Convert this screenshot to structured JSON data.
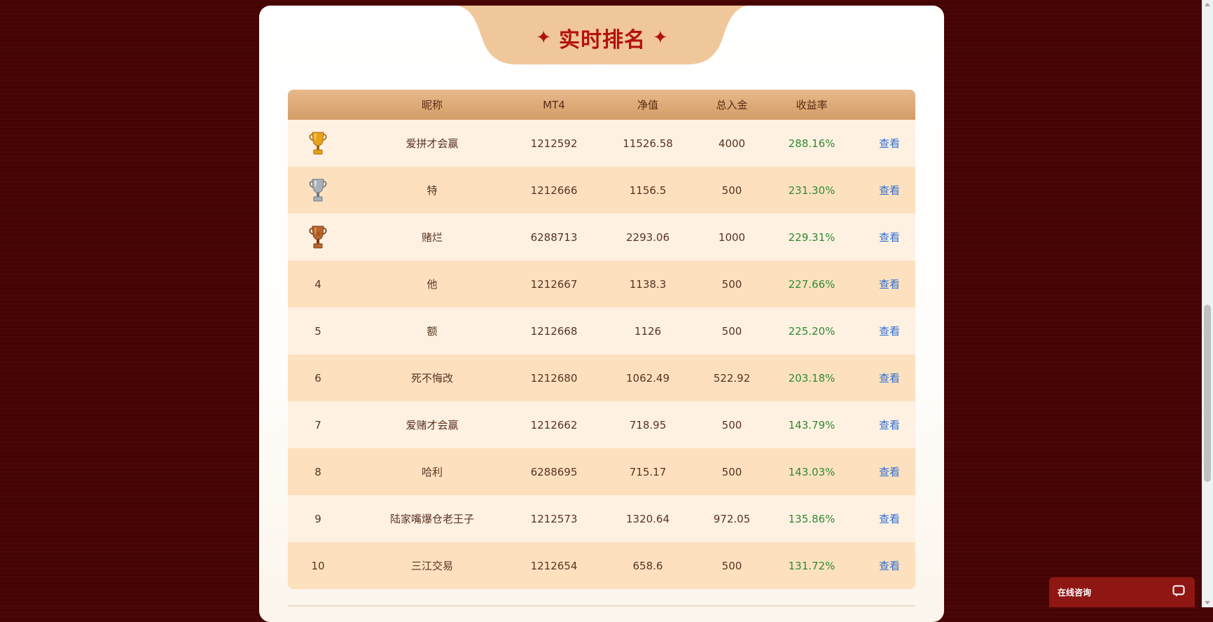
{
  "title": "实时排名",
  "title_star": "✦",
  "columns": {
    "rank": "",
    "name": "昵称",
    "mt4": "MT4",
    "nav": "净值",
    "deposit": "总入金",
    "rate": "收益率",
    "action": ""
  },
  "rows": [
    {
      "rank": "1",
      "rank_icon": "gold-trophy-icon",
      "name": "爱拼才会赢",
      "mt4": "1212592",
      "nav": "11526.58",
      "deposit": "4000",
      "rate": "288.16%",
      "action": "查看"
    },
    {
      "rank": "2",
      "rank_icon": "silver-trophy-icon",
      "name": "特",
      "mt4": "1212666",
      "nav": "1156.5",
      "deposit": "500",
      "rate": "231.30%",
      "action": "查看"
    },
    {
      "rank": "3",
      "rank_icon": "bronze-trophy-icon",
      "name": "赌烂",
      "mt4": "6288713",
      "nav": "2293.06",
      "deposit": "1000",
      "rate": "229.31%",
      "action": "查看"
    },
    {
      "rank": "4",
      "name": "他",
      "mt4": "1212667",
      "nav": "1138.3",
      "deposit": "500",
      "rate": "227.66%",
      "action": "查看"
    },
    {
      "rank": "5",
      "name": "额",
      "mt4": "1212668",
      "nav": "1126",
      "deposit": "500",
      "rate": "225.20%",
      "action": "查看"
    },
    {
      "rank": "6",
      "name": "死不悔改",
      "mt4": "1212680",
      "nav": "1062.49",
      "deposit": "522.92",
      "rate": "203.18%",
      "action": "查看"
    },
    {
      "rank": "7",
      "name": "爱赌才会赢",
      "mt4": "1212662",
      "nav": "718.95",
      "deposit": "500",
      "rate": "143.79%",
      "action": "查看"
    },
    {
      "rank": "8",
      "name": "哈利",
      "mt4": "6288695",
      "nav": "715.17",
      "deposit": "500",
      "rate": "143.03%",
      "action": "查看"
    },
    {
      "rank": "9",
      "name": "陆家嘴爆仓老王子",
      "mt4": "1212573",
      "nav": "1320.64",
      "deposit": "972.05",
      "rate": "135.86%",
      "action": "查看"
    },
    {
      "rank": "10",
      "name": "三江交易",
      "mt4": "1212654",
      "nav": "658.6",
      "deposit": "500",
      "rate": "131.72%",
      "action": "查看"
    }
  ],
  "chat": {
    "label": "在线咨询",
    "icon": "chat-bubble-icon"
  },
  "colors": {
    "background": "#4a0606",
    "title": "#b3120c",
    "header_gold": "#d49d67",
    "row_light": "#fff1e2",
    "row_dark": "#fde1bf",
    "rate_green": "#2f8a32",
    "link_blue": "#2f6fd1",
    "chat_bg": "#8e1613"
  }
}
